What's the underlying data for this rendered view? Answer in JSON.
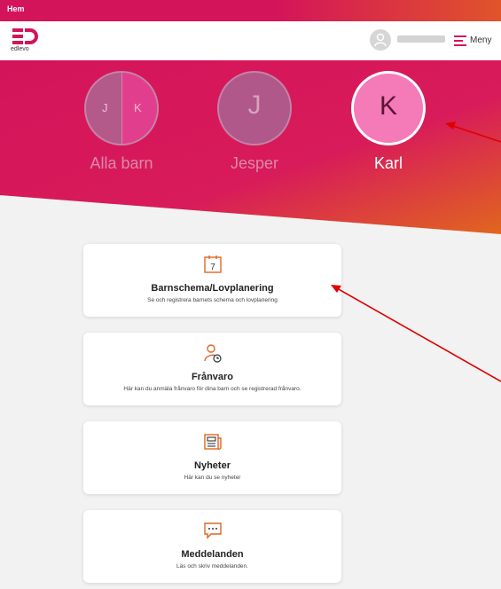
{
  "topbar": {
    "title": "Hem"
  },
  "header": {
    "logo_text": "edlevo",
    "menu_label": "Meny"
  },
  "children": [
    {
      "label": "Alla barn",
      "initials": [
        "J",
        "K"
      ]
    },
    {
      "label": "Jesper",
      "initial": "J"
    },
    {
      "label": "Karl",
      "initial": "K",
      "selected": true
    }
  ],
  "cards": [
    {
      "icon": "calendar-icon",
      "title": "Barnschema/Lovplanering",
      "description": "Se och registrera barnets schema och lovplanering"
    },
    {
      "icon": "person-clock-icon",
      "title": "Frånvaro",
      "description": "Här kan du anmäla frånvaro för dina barn och se registrerad frånvaro."
    },
    {
      "icon": "newspaper-icon",
      "title": "Nyheter",
      "description": "Här kan du se nyheter"
    },
    {
      "icon": "chat-icon",
      "title": "Meddelanden",
      "description": "Läs och skriv meddelanden."
    }
  ],
  "calendar_icon_number": "7",
  "colors": {
    "brand_pink": "#d4145a",
    "brand_orange": "#e06a1a",
    "annotation_red": "#e00000"
  }
}
